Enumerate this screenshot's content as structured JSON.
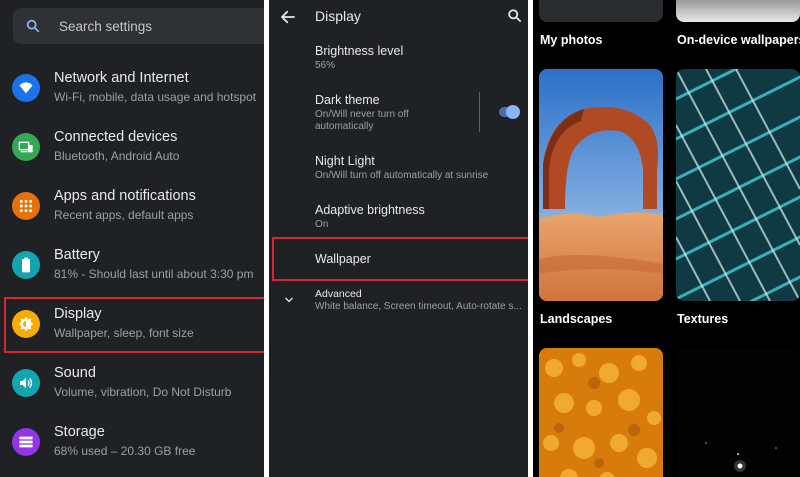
{
  "settings": {
    "search_placeholder": "Search settings",
    "items": [
      {
        "title": "Network and Internet",
        "subtitle": "Wi-Fi, mobile, data usage and hotspot",
        "icon": "wifi-icon",
        "color": "#1a73e8"
      },
      {
        "title": "Connected devices",
        "subtitle": "Bluetooth, Android Auto",
        "icon": "devices-icon",
        "color": "#34a853"
      },
      {
        "title": "Apps and notifications",
        "subtitle": "Recent apps, default apps",
        "icon": "apps-icon",
        "color": "#e8710a"
      },
      {
        "title": "Battery",
        "subtitle": "81% - Should last until about 3:30 pm",
        "icon": "battery-icon",
        "color": "#12a4af"
      },
      {
        "title": "Display",
        "subtitle": "Wallpaper, sleep, font size",
        "icon": "brightness-icon",
        "color": "#f9ab00"
      },
      {
        "title": "Sound",
        "subtitle": "Volume, vibration, Do Not Disturb",
        "icon": "volume-icon",
        "color": "#12a4af"
      },
      {
        "title": "Storage",
        "subtitle": "68% used – 20.30 GB free",
        "icon": "storage-icon",
        "color": "#9334e6"
      }
    ]
  },
  "display": {
    "title": "Display",
    "items": [
      {
        "title": "Brightness level",
        "subtitle": "56%"
      },
      {
        "title": "Dark theme",
        "subtitle": "On/Will never turn off automatically",
        "toggle_on": true
      },
      {
        "title": "Night Light",
        "subtitle": "On/Will turn off automatically at sunrise"
      },
      {
        "title": "Adaptive brightness",
        "subtitle": "On"
      },
      {
        "title": "Wallpaper",
        "subtitle": ""
      },
      {
        "title": "Advanced",
        "subtitle": "White balance, Screen timeout, Auto-rotate s..."
      }
    ]
  },
  "wallpapers": {
    "categories": [
      "My photos",
      "On-device wallpapers",
      "Landscapes",
      "Textures"
    ]
  },
  "colors": {
    "highlight": "#d72631",
    "accent": "#8ab4f8"
  }
}
